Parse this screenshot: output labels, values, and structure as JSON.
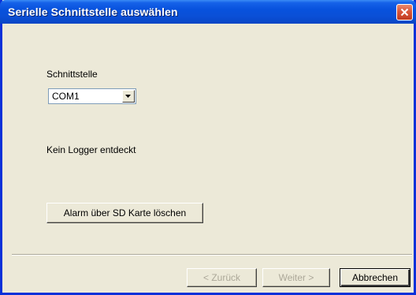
{
  "window": {
    "title": "Serielle Schnittstelle auswählen"
  },
  "icons": {
    "close": "close-icon",
    "dropdown": "chevron-down-icon"
  },
  "interface": {
    "label": "Schnittstelle",
    "selected": "COM1"
  },
  "status": {
    "text": "Kein Logger entdeckt"
  },
  "actions": {
    "alarm_button": "Alarm über SD Karte löschen"
  },
  "footer": {
    "back_button": "< Zurück",
    "next_button": "Weiter >",
    "cancel_button": "Abbrechen"
  },
  "colors": {
    "titlebar": "#0a4fd6",
    "window_background": "#ece9d8",
    "close_button": "#d9563a",
    "disabled_text": "#aca899"
  }
}
